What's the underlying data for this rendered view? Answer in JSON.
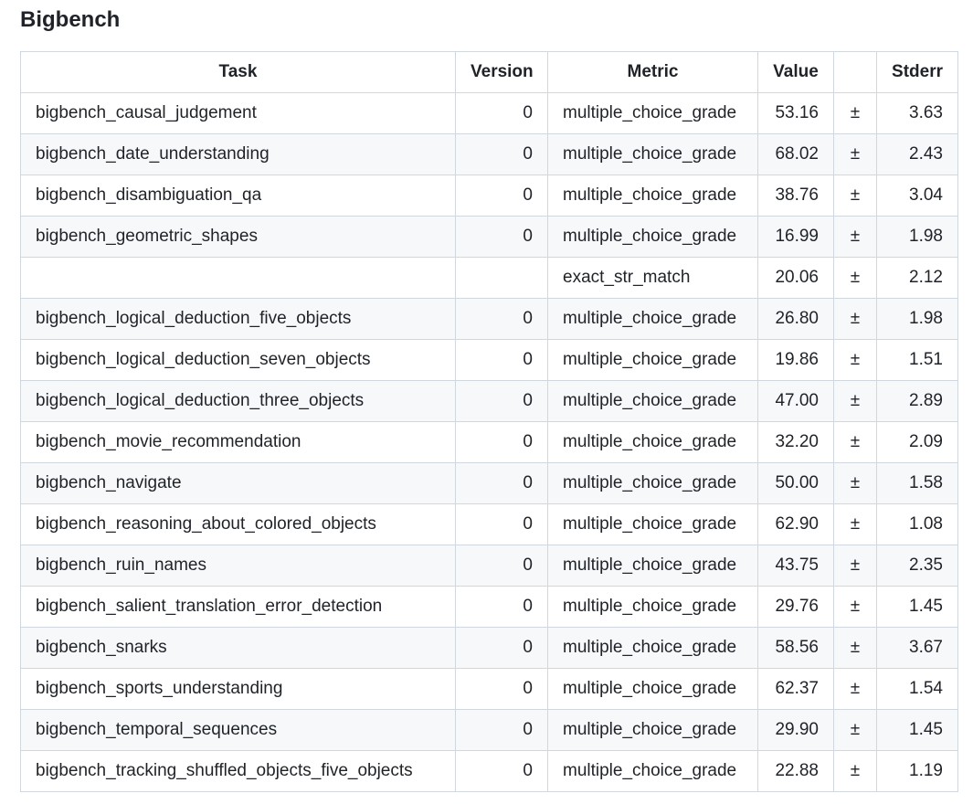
{
  "section": {
    "title": "Bigbench"
  },
  "table": {
    "headers": {
      "task": "Task",
      "version": "Version",
      "metric": "Metric",
      "value": "Value",
      "pm": "",
      "stderr": "Stderr"
    },
    "rows": [
      {
        "task": "bigbench_causal_judgement",
        "version": "0",
        "metric": "multiple_choice_grade",
        "value": "53.16",
        "pm": "±",
        "stderr": "3.63"
      },
      {
        "task": "bigbench_date_understanding",
        "version": "0",
        "metric": "multiple_choice_grade",
        "value": "68.02",
        "pm": "±",
        "stderr": "2.43"
      },
      {
        "task": "bigbench_disambiguation_qa",
        "version": "0",
        "metric": "multiple_choice_grade",
        "value": "38.76",
        "pm": "±",
        "stderr": "3.04"
      },
      {
        "task": "bigbench_geometric_shapes",
        "version": "0",
        "metric": "multiple_choice_grade",
        "value": "16.99",
        "pm": "±",
        "stderr": "1.98"
      },
      {
        "task": "",
        "version": "",
        "metric": "exact_str_match",
        "value": "20.06",
        "pm": "±",
        "stderr": "2.12"
      },
      {
        "task": "bigbench_logical_deduction_five_objects",
        "version": "0",
        "metric": "multiple_choice_grade",
        "value": "26.80",
        "pm": "±",
        "stderr": "1.98"
      },
      {
        "task": "bigbench_logical_deduction_seven_objects",
        "version": "0",
        "metric": "multiple_choice_grade",
        "value": "19.86",
        "pm": "±",
        "stderr": "1.51"
      },
      {
        "task": "bigbench_logical_deduction_three_objects",
        "version": "0",
        "metric": "multiple_choice_grade",
        "value": "47.00",
        "pm": "±",
        "stderr": "2.89"
      },
      {
        "task": "bigbench_movie_recommendation",
        "version": "0",
        "metric": "multiple_choice_grade",
        "value": "32.20",
        "pm": "±",
        "stderr": "2.09"
      },
      {
        "task": "bigbench_navigate",
        "version": "0",
        "metric": "multiple_choice_grade",
        "value": "50.00",
        "pm": "±",
        "stderr": "1.58"
      },
      {
        "task": "bigbench_reasoning_about_colored_objects",
        "version": "0",
        "metric": "multiple_choice_grade",
        "value": "62.90",
        "pm": "±",
        "stderr": "1.08"
      },
      {
        "task": "bigbench_ruin_names",
        "version": "0",
        "metric": "multiple_choice_grade",
        "value": "43.75",
        "pm": "±",
        "stderr": "2.35"
      },
      {
        "task": "bigbench_salient_translation_error_detection",
        "version": "0",
        "metric": "multiple_choice_grade",
        "value": "29.76",
        "pm": "±",
        "stderr": "1.45"
      },
      {
        "task": "bigbench_snarks",
        "version": "0",
        "metric": "multiple_choice_grade",
        "value": "58.56",
        "pm": "±",
        "stderr": "3.67"
      },
      {
        "task": "bigbench_sports_understanding",
        "version": "0",
        "metric": "multiple_choice_grade",
        "value": "62.37",
        "pm": "±",
        "stderr": "1.54"
      },
      {
        "task": "bigbench_temporal_sequences",
        "version": "0",
        "metric": "multiple_choice_grade",
        "value": "29.90",
        "pm": "±",
        "stderr": "1.45"
      },
      {
        "task": "bigbench_tracking_shuffled_objects_five_objects",
        "version": "0",
        "metric": "multiple_choice_grade",
        "value": "22.88",
        "pm": "±",
        "stderr": "1.19"
      }
    ]
  }
}
